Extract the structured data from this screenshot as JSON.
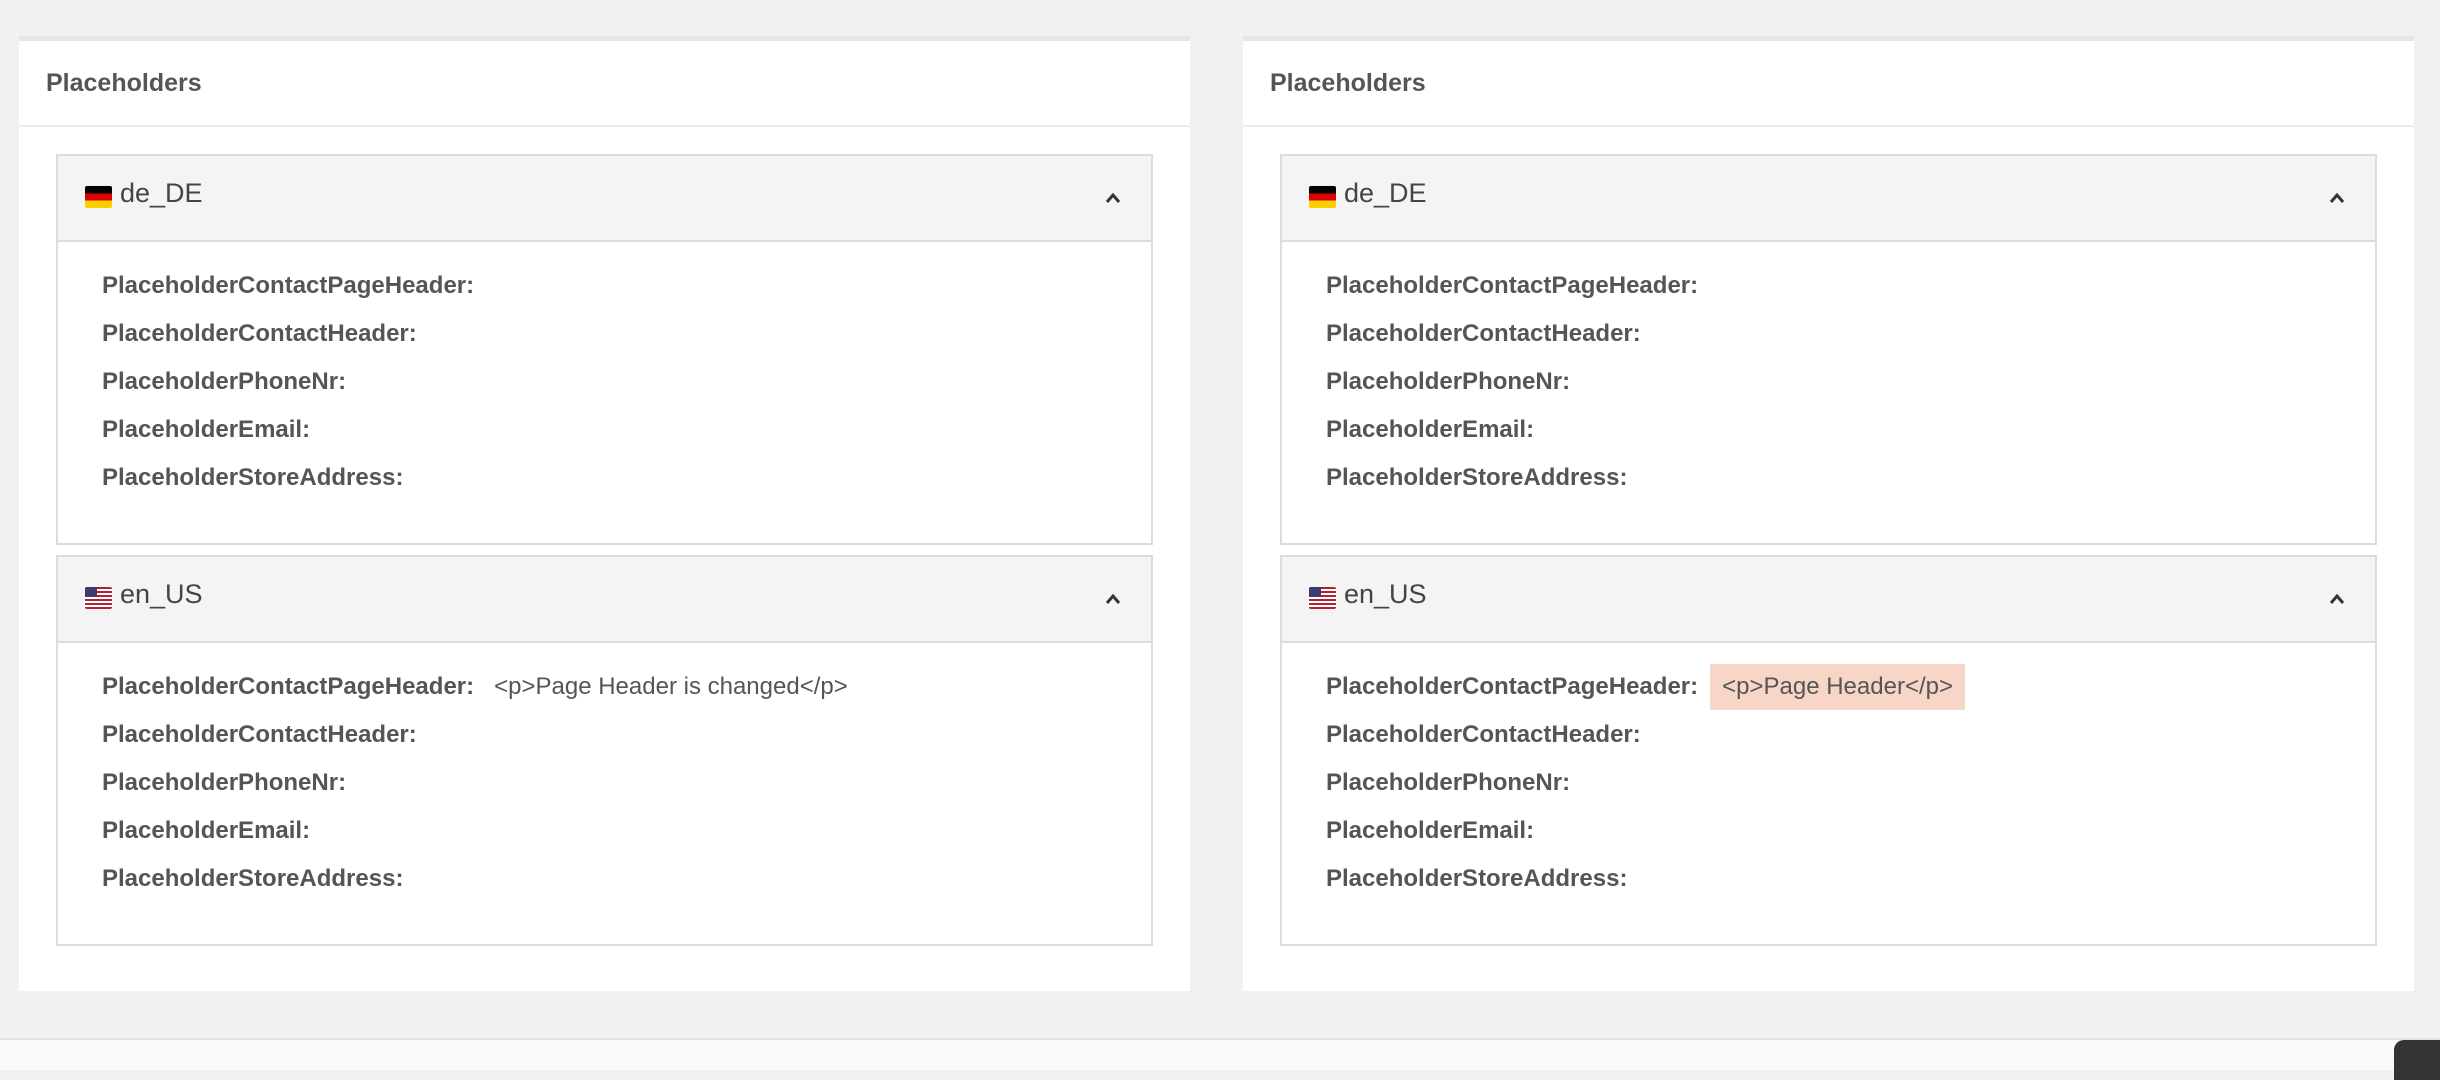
{
  "panels": [
    {
      "title": "Placeholders",
      "locales": [
        {
          "code": "de_DE",
          "rows": [
            {
              "key": "PlaceholderContactPageHeader:",
              "value": ""
            },
            {
              "key": "PlaceholderContactHeader:",
              "value": ""
            },
            {
              "key": "PlaceholderPhoneNr:",
              "value": ""
            },
            {
              "key": "PlaceholderEmail:",
              "value": ""
            },
            {
              "key": "PlaceholderStoreAddress:",
              "value": ""
            }
          ]
        },
        {
          "code": "en_US",
          "rows": [
            {
              "key": "PlaceholderContactPageHeader:",
              "value": "<p>Page Header is changed</p>"
            },
            {
              "key": "PlaceholderContactHeader:",
              "value": ""
            },
            {
              "key": "PlaceholderPhoneNr:",
              "value": ""
            },
            {
              "key": "PlaceholderEmail:",
              "value": ""
            },
            {
              "key": "PlaceholderStoreAddress:",
              "value": ""
            }
          ]
        }
      ]
    },
    {
      "title": "Placeholders",
      "locales": [
        {
          "code": "de_DE",
          "rows": [
            {
              "key": "PlaceholderContactPageHeader:",
              "value": ""
            },
            {
              "key": "PlaceholderContactHeader:",
              "value": ""
            },
            {
              "key": "PlaceholderPhoneNr:",
              "value": ""
            },
            {
              "key": "PlaceholderEmail:",
              "value": ""
            },
            {
              "key": "PlaceholderStoreAddress:",
              "value": ""
            }
          ]
        },
        {
          "code": "en_US",
          "rows": [
            {
              "key": "PlaceholderContactPageHeader:",
              "value": "<p>Page Header</p>"
            },
            {
              "key": "PlaceholderContactHeader:",
              "value": ""
            },
            {
              "key": "PlaceholderPhoneNr:",
              "value": ""
            },
            {
              "key": "PlaceholderEmail:",
              "value": ""
            },
            {
              "key": "PlaceholderStoreAddress:",
              "value": ""
            }
          ]
        }
      ]
    }
  ],
  "diff_color": "#f8d6c7",
  "icons": {
    "flag_de": "flag-de-icon",
    "flag_us": "flag-us-icon",
    "collapse": "chevron-up-icon"
  }
}
